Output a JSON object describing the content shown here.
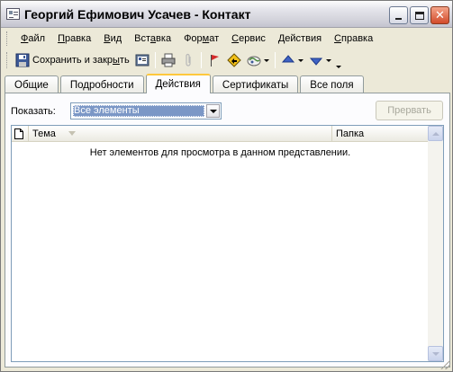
{
  "window": {
    "title": "Георгий Ефимович Усачев - Контакт",
    "icons": {
      "app": "contact-card-icon",
      "minimize": "minimize-icon",
      "maximize": "maximize-icon",
      "close": "close-icon"
    },
    "close_glyph": "✕"
  },
  "menu": {
    "items": [
      {
        "pre": "",
        "u": "Ф",
        "post": "айл"
      },
      {
        "pre": "",
        "u": "П",
        "post": "равка"
      },
      {
        "pre": "",
        "u": "В",
        "post": "ид"
      },
      {
        "pre": "Вст",
        "u": "а",
        "post": "вка"
      },
      {
        "pre": "Фор",
        "u": "м",
        "post": "ат"
      },
      {
        "pre": "",
        "u": "С",
        "post": "ервис"
      },
      {
        "pre": "",
        "u": "Д",
        "post": "ействия"
      },
      {
        "pre": "",
        "u": "С",
        "post": "правка"
      }
    ]
  },
  "toolbar": {
    "save_close_label_pre": "Сохранить и закр",
    "save_close_label_u": "ы",
    "save_close_label_post": "ть",
    "icons": [
      "save-icon",
      "save-as-card-icon",
      "print-icon",
      "attach-icon",
      "flag-icon",
      "activity-icon",
      "map-address-icon",
      "previous-item-icon",
      "next-item-icon"
    ]
  },
  "tabs": [
    {
      "label": "Общие",
      "active": false
    },
    {
      "label": "Подробности",
      "active": false
    },
    {
      "label": "Действия",
      "active": true
    },
    {
      "label": "Сертификаты",
      "active": false
    },
    {
      "label": "Все поля",
      "active": false
    }
  ],
  "activities": {
    "show_label": "Показать:",
    "show_value": "Все элементы",
    "interrupt_label": "Прервать",
    "interrupt_enabled": false,
    "columns": {
      "subject": "Тема",
      "folder": "Папка"
    },
    "empty_message": "Нет элементов для просмотра в данном представлении."
  },
  "colors": {
    "accent_tab": "#ffc83c",
    "selection": "#7b97c6",
    "panel": "#fcfcfe",
    "window_bg": "#ece9d8"
  }
}
